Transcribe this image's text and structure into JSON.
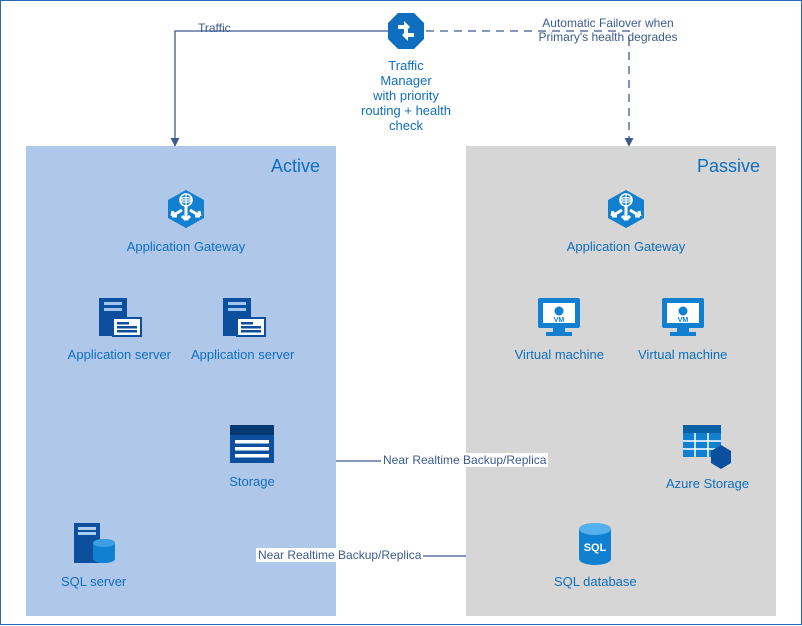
{
  "traffic_manager": {
    "label": "Traffic Manager\nwith priority\nrouting + health\ncheck"
  },
  "edges": {
    "traffic": "Traffic",
    "failover": "Automatic Failover when\nPrimary's health degrades",
    "replica": "Near Realtime Backup/Replica"
  },
  "active": {
    "title": "Active",
    "app_gateway": "Application Gateway",
    "server": "Application server",
    "storage": "Storage",
    "sql": "SQL server"
  },
  "passive": {
    "title": "Passive",
    "app_gateway": "Application Gateway",
    "vm": "Virtual machine",
    "storage": "Azure Storage",
    "sql": "SQL database"
  },
  "colors": {
    "azure_blue": "#106ebe",
    "line": "#3d5b8f",
    "active_bg": "#afc8e9",
    "passive_bg": "#d6d6d6"
  }
}
